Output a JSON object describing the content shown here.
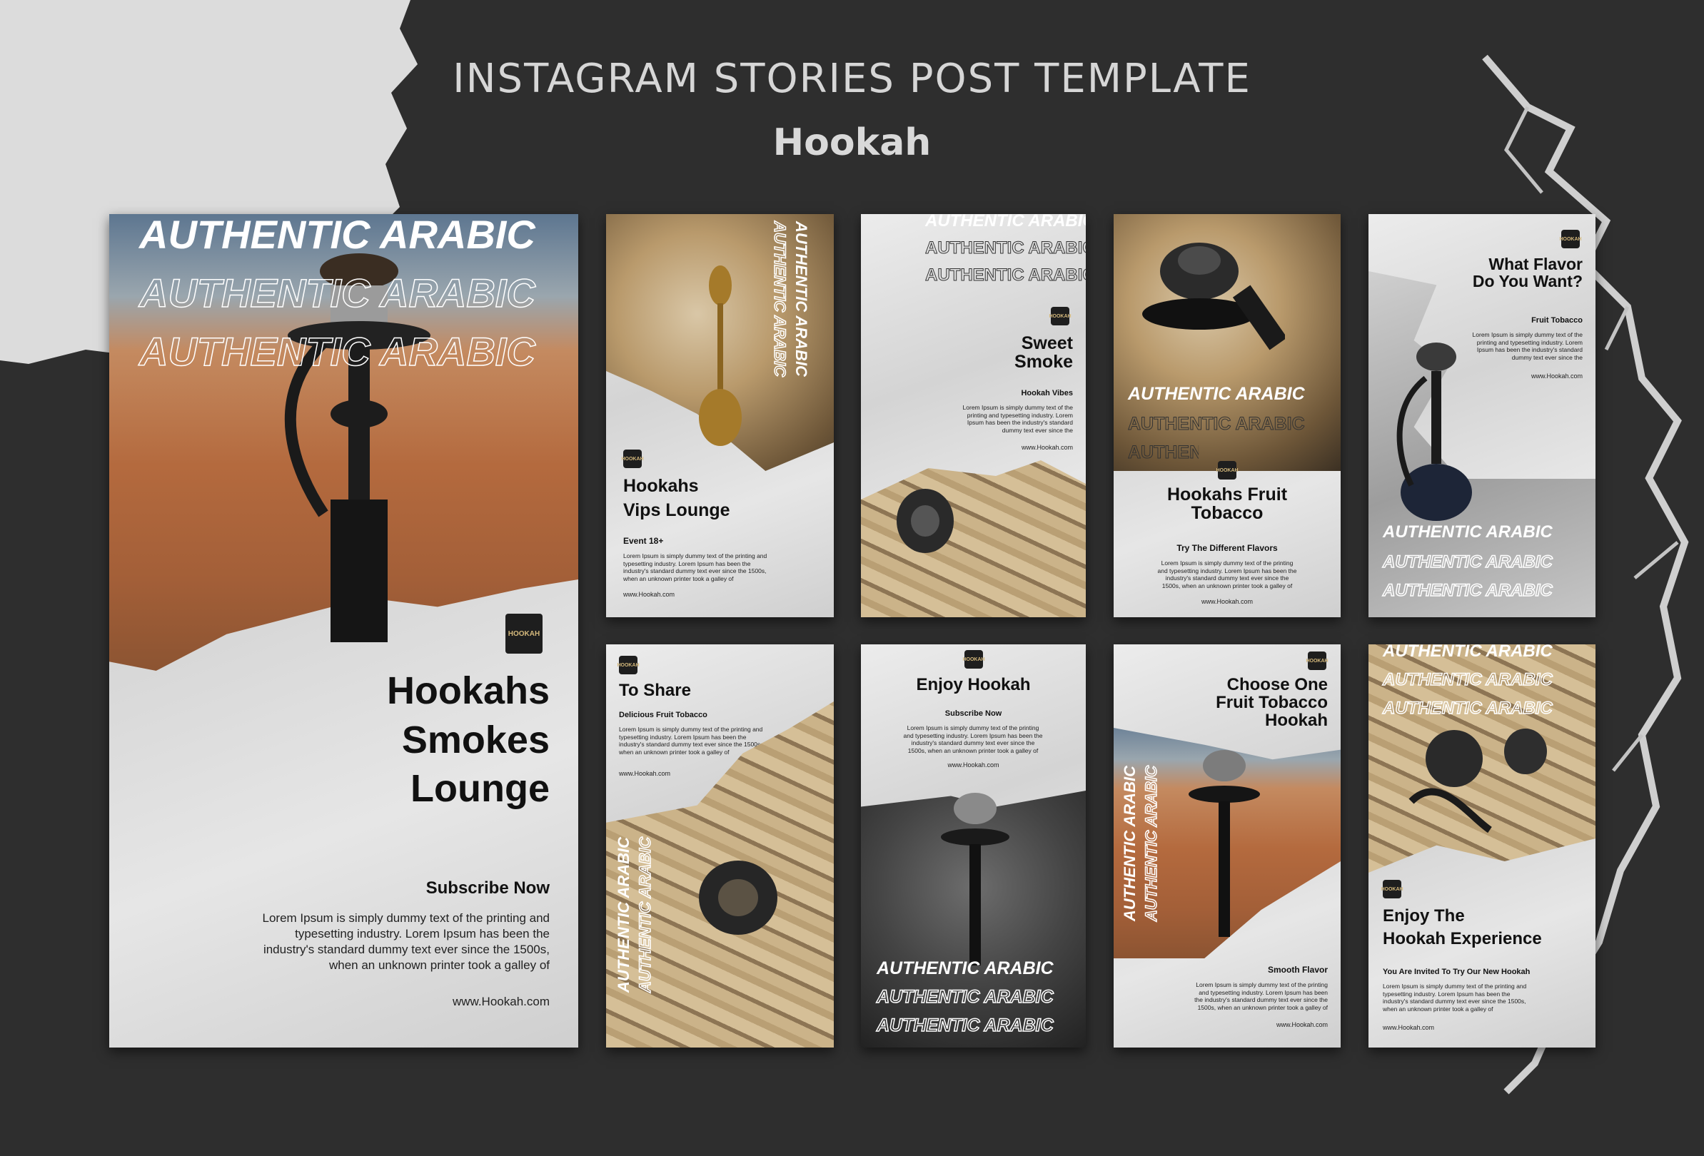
{
  "header": {
    "title": "INSTAGRAM STORIES POST TEMPLATE",
    "subtitle": "Hookah"
  },
  "logo_text": "HOOKAH",
  "big_card": {
    "banner": "AUTHENTIC ARABIC",
    "headline": [
      "Hookahs",
      "Smokes",
      "Lounge"
    ],
    "cta": "Subscribe Now",
    "body": "Lorem Ipsum is simply dummy text of the printing and typesetting industry. Lorem Ipsum has been the industry's standard dummy text ever since the 1500s, when an unknown printer took a galley of",
    "url": "www.Hookah.com"
  },
  "cards": [
    {
      "banner": "AUTHENTIC ARABIC",
      "headline": [
        "Hookahs",
        "Vips Lounge"
      ],
      "subhead": "Event 18+",
      "body": "Lorem Ipsum is simply dummy text of the printing and typesetting industry. Lorem Ipsum has been the industry's standard dummy text ever since the 1500s, when an unknown printer took a galley of",
      "url": "www.Hookah.com"
    },
    {
      "banner": "AUTHENTIC ARABIC",
      "headline": [
        "Sweet",
        "Smoke"
      ],
      "subhead": "Hookah Vibes",
      "body": "Lorem Ipsum is simply dummy text of the printing and typesetting industry. Lorem Ipsum has been the industry's standard dummy text ever since the",
      "url": "www.Hookah.com"
    },
    {
      "banner": "AUTHENTIC ARABIC",
      "headline": [
        "Hookahs Fruit",
        "Tobacco"
      ],
      "subhead": "Try The Different Flavors",
      "body": "Lorem Ipsum is simply dummy text of the printing and typesetting industry. Lorem Ipsum has been the industry's standard dummy text ever since the 1500s, when an unknown printer took a galley of",
      "url": "www.Hookah.com"
    },
    {
      "banner": "AUTHENTIC ARABIC",
      "headline": [
        "What Flavor",
        "Do You Want?"
      ],
      "subhead": "Fruit Tobacco",
      "body": "Lorem Ipsum is simply dummy text of the printing and typesetting industry. Lorem Ipsum has been the industry's standard dummy text ever since the",
      "url": "www.Hookah.com"
    },
    {
      "banner": "AUTHENTIC ARABIC",
      "headline": [
        "To Share"
      ],
      "subhead": "Delicious Fruit Tobacco",
      "body": "Lorem Ipsum is simply dummy text of the printing and typesetting industry. Lorem Ipsum has been the industry's standard dummy text ever since the 1500s, when an unknown printer took a galley of",
      "url": "www.Hookah.com"
    },
    {
      "banner": "AUTHENTIC ARABIC",
      "headline": [
        "Enjoy Hookah"
      ],
      "subhead": "Subscribe Now",
      "body": "Lorem Ipsum is simply dummy text of the printing and typesetting industry. Lorem Ipsum has been the industry's standard dummy text ever since the 1500s, when an unknown printer took a galley of",
      "url": "www.Hookah.com"
    },
    {
      "banner": "AUTHENTIC ARABIC",
      "headline": [
        "Choose One",
        "Fruit Tobacco",
        "Hookah"
      ],
      "subhead": "Smooth Flavor",
      "body": "Lorem Ipsum is simply dummy text of the printing and typesetting industry. Lorem Ipsum has been the industry's standard dummy text ever since the 1500s, when an unknown printer took a galley of",
      "url": "www.Hookah.com"
    },
    {
      "banner": "AUTHENTIC ARABIC",
      "headline": [
        "Enjoy The",
        "Hookah Experience"
      ],
      "subhead": "You Are Invited To Try Our New Hookah",
      "body": "Lorem Ipsum is simply dummy text of the printing and typesetting industry. Lorem Ipsum has been the industry's standard dummy text ever since the 1500s, when an unknown printer took a galley of",
      "url": "www.Hookah.com"
    }
  ]
}
